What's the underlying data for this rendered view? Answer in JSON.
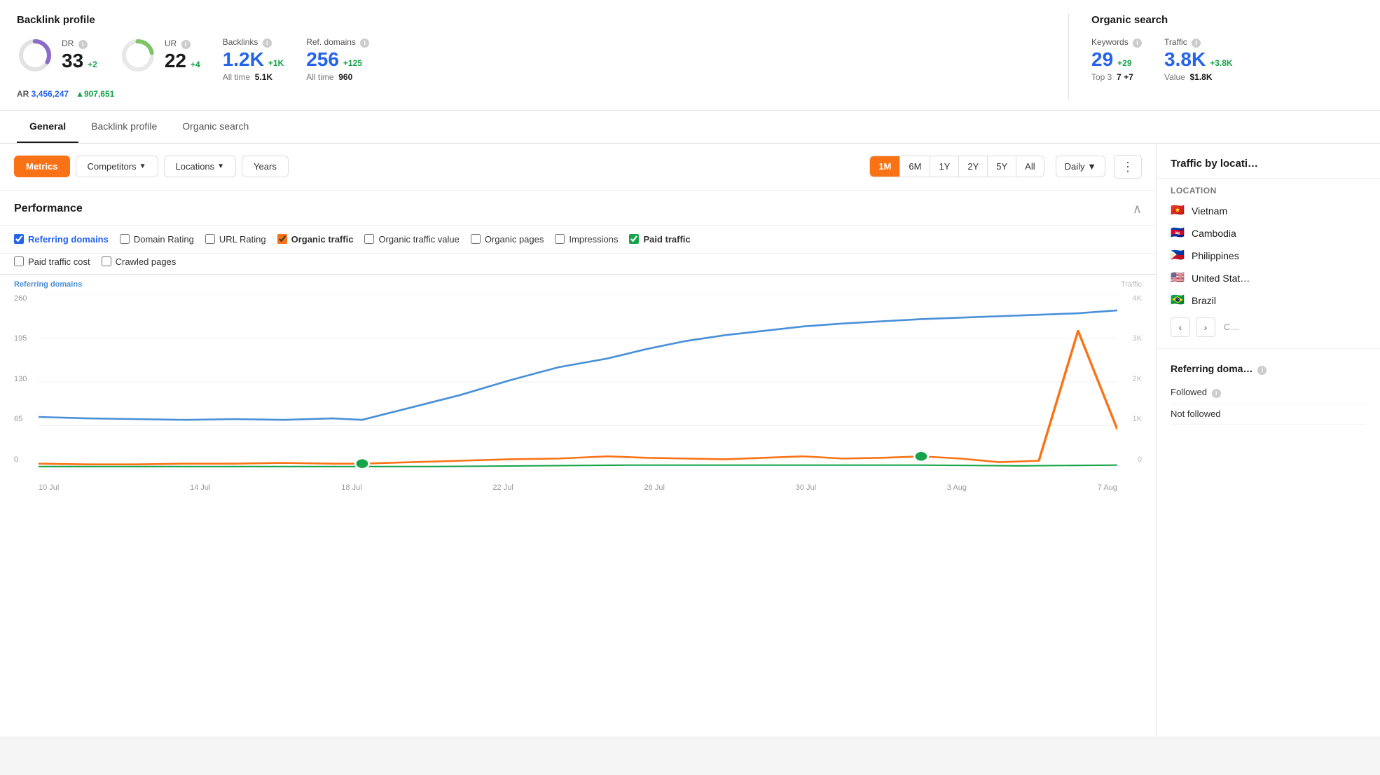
{
  "backlink_profile": {
    "title": "Backlink profile",
    "dr": {
      "label": "DR",
      "value": "33",
      "delta": "+2",
      "progress": 33
    },
    "ur": {
      "label": "UR",
      "value": "22",
      "delta": "+4",
      "progress": 22
    },
    "backlinks": {
      "label": "Backlinks",
      "value": "1.2K",
      "delta": "+1K",
      "alltime_label": "All time",
      "alltime_value": "5.1K"
    },
    "ref_domains": {
      "label": "Ref. domains",
      "value": "256",
      "delta": "+125",
      "alltime_label": "All time",
      "alltime_value": "960"
    },
    "ar": {
      "label": "AR",
      "value": "3,456,247",
      "delta": "▲907,651"
    }
  },
  "organic_search": {
    "title": "Organic search",
    "keywords": {
      "label": "Keywords",
      "value": "29",
      "delta": "+29",
      "top3_label": "Top 3",
      "top3_value": "7",
      "top3_delta": "+7"
    },
    "traffic": {
      "label": "Traffic",
      "value": "3.8K",
      "delta": "+3.8K",
      "value_label": "Value",
      "value_amount": "$1.8K"
    }
  },
  "nav_tabs": [
    {
      "id": "general",
      "label": "General",
      "active": true
    },
    {
      "id": "backlink-profile",
      "label": "Backlink profile",
      "active": false
    },
    {
      "id": "organic-search",
      "label": "Organic search",
      "active": false
    }
  ],
  "toolbar": {
    "metrics_label": "Metrics",
    "competitors_label": "Competitors",
    "locations_label": "Locations",
    "years_label": "Years",
    "time_buttons": [
      "1M",
      "6M",
      "1Y",
      "2Y",
      "5Y",
      "All"
    ],
    "active_time": "1M",
    "daily_label": "Daily"
  },
  "performance": {
    "title": "Performance",
    "checkboxes": [
      {
        "id": "ref-domains",
        "label": "Referring domains",
        "checked": true,
        "type": "blue"
      },
      {
        "id": "domain-rating",
        "label": "Domain Rating",
        "checked": false,
        "type": "normal"
      },
      {
        "id": "url-rating",
        "label": "URL Rating",
        "checked": false,
        "type": "normal"
      },
      {
        "id": "organic-traffic",
        "label": "Organic traffic",
        "checked": true,
        "type": "orange",
        "bold": true
      },
      {
        "id": "organic-traffic-value",
        "label": "Organic traffic value",
        "checked": false,
        "type": "normal"
      },
      {
        "id": "organic-pages",
        "label": "Organic pages",
        "checked": false,
        "type": "normal"
      },
      {
        "id": "impressions",
        "label": "Impressions",
        "checked": false,
        "type": "normal"
      },
      {
        "id": "paid-traffic",
        "label": "Paid traffic",
        "checked": true,
        "type": "green",
        "bold": true
      },
      {
        "id": "paid-traffic-cost",
        "label": "Paid traffic cost",
        "checked": false,
        "type": "normal"
      },
      {
        "id": "crawled-pages",
        "label": "Crawled pages",
        "checked": false,
        "type": "normal"
      }
    ]
  },
  "chart": {
    "left_axis_label": "Referring domains",
    "right_axis_label": "Traffic",
    "left_values": [
      "260",
      "195",
      "130",
      "65",
      "0"
    ],
    "right_values": [
      "4K",
      "3K",
      "2K",
      "1K",
      "0"
    ],
    "x_labels": [
      "10 Jul",
      "14 Jul",
      "18 Jul",
      "22 Jul",
      "26 Jul",
      "30 Jul",
      "3 Aug",
      "7 Aug"
    ]
  },
  "right_panel": {
    "title": "Traffic by locati…",
    "location_header": "Location",
    "locations": [
      {
        "flag": "🇻🇳",
        "name": "Vietnam"
      },
      {
        "flag": "🇰🇭",
        "name": "Cambodia"
      },
      {
        "flag": "🇵🇭",
        "name": "Philippines"
      },
      {
        "flag": "🇺🇸",
        "name": "United Stat…"
      },
      {
        "flag": "🇧🇷",
        "name": "Brazil"
      }
    ],
    "ref_domains_title": "Referring doma…",
    "ref_domain_items": [
      {
        "label": "Followed"
      },
      {
        "label": "Not followed"
      }
    ]
  }
}
